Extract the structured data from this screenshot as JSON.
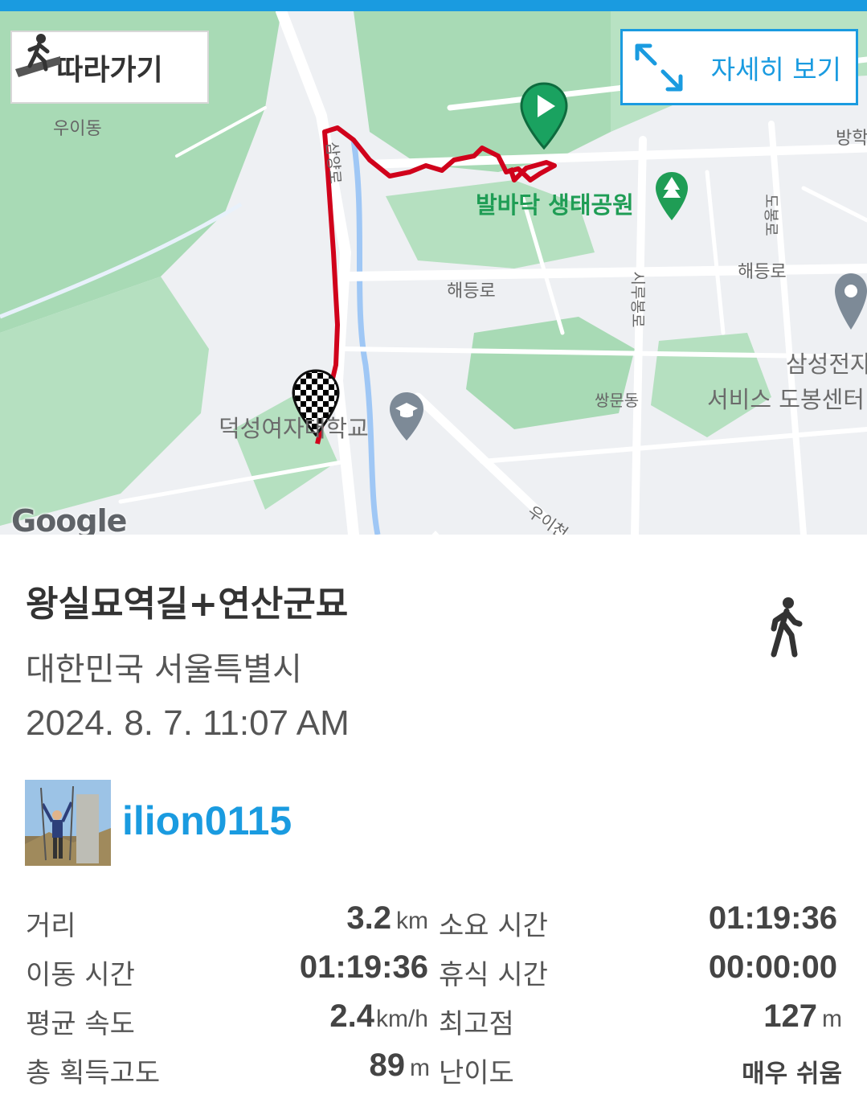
{
  "map": {
    "follow_label": "따라가기",
    "detail_label": "자세히 보기",
    "attribution": "Google",
    "places": {
      "uidong": "우이동",
      "park": "발바닥 생태공원",
      "haedeungro_1": "해등로",
      "haedeungro_2": "해등로",
      "ssangmundong": "쌍문동",
      "university": "덕성여자대학교",
      "samsung_1": "삼성전자",
      "samsung_2": "서비스 도봉센터",
      "banghak": "방학",
      "samyangro": "삼양로",
      "sirubong": "시루봉로",
      "uicheon": "우이천",
      "dobong": "도봉로"
    }
  },
  "track": {
    "title": "왕실묘역길+연산군묘",
    "location": "대한민국 서울특별시",
    "datetime": "2024. 8. 7. 11:07 AM",
    "activity_icon": "walking-person-icon"
  },
  "user": {
    "username": "ilion0115",
    "avatar_icon": "user-avatar-photo"
  },
  "stats": {
    "distance_label": "거리",
    "distance_value": "3.2",
    "distance_unit": "km",
    "duration_label": "소요 시간",
    "duration_value": "01:19:36",
    "moving_label": "이동 시간",
    "moving_value": "01:19:36",
    "rest_label": "휴식 시간",
    "rest_value": "00:00:00",
    "speed_label": "평균 속도",
    "speed_value": "2.4",
    "speed_unit": "km/h",
    "max_elev_label": "최고점",
    "max_elev_value": "127",
    "max_elev_unit": "m",
    "gain_label": "총 획득고도",
    "gain_value": "89",
    "gain_unit": "m",
    "difficulty_label": "난이도",
    "difficulty_value": "매우 쉬움"
  },
  "colors": {
    "accent": "#1a9be0",
    "route": "#d0021b",
    "park_green": "#a8dab5",
    "start_marker": "#1aa260"
  }
}
